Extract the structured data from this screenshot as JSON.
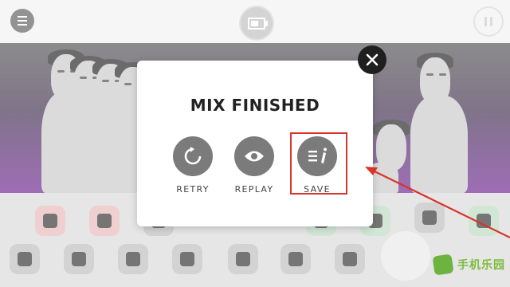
{
  "modal": {
    "title": "MIX FINISHED",
    "actions": [
      {
        "label": "RETRY",
        "icon": "retry-icon"
      },
      {
        "label": "REPLAY",
        "icon": "eye-icon"
      },
      {
        "label": "SAVE",
        "icon": "save-mix-icon"
      }
    ]
  },
  "topbar": {
    "menu_icon": "menu-icon",
    "battery_icon": "battery-icon",
    "pause_icon": "pause-icon"
  },
  "watermark": {
    "text": "手机乐园"
  },
  "colors": {
    "highlight": "#d8342b",
    "scene_purple": "#6a1f8f",
    "action_circle": "#7b7b7b"
  }
}
